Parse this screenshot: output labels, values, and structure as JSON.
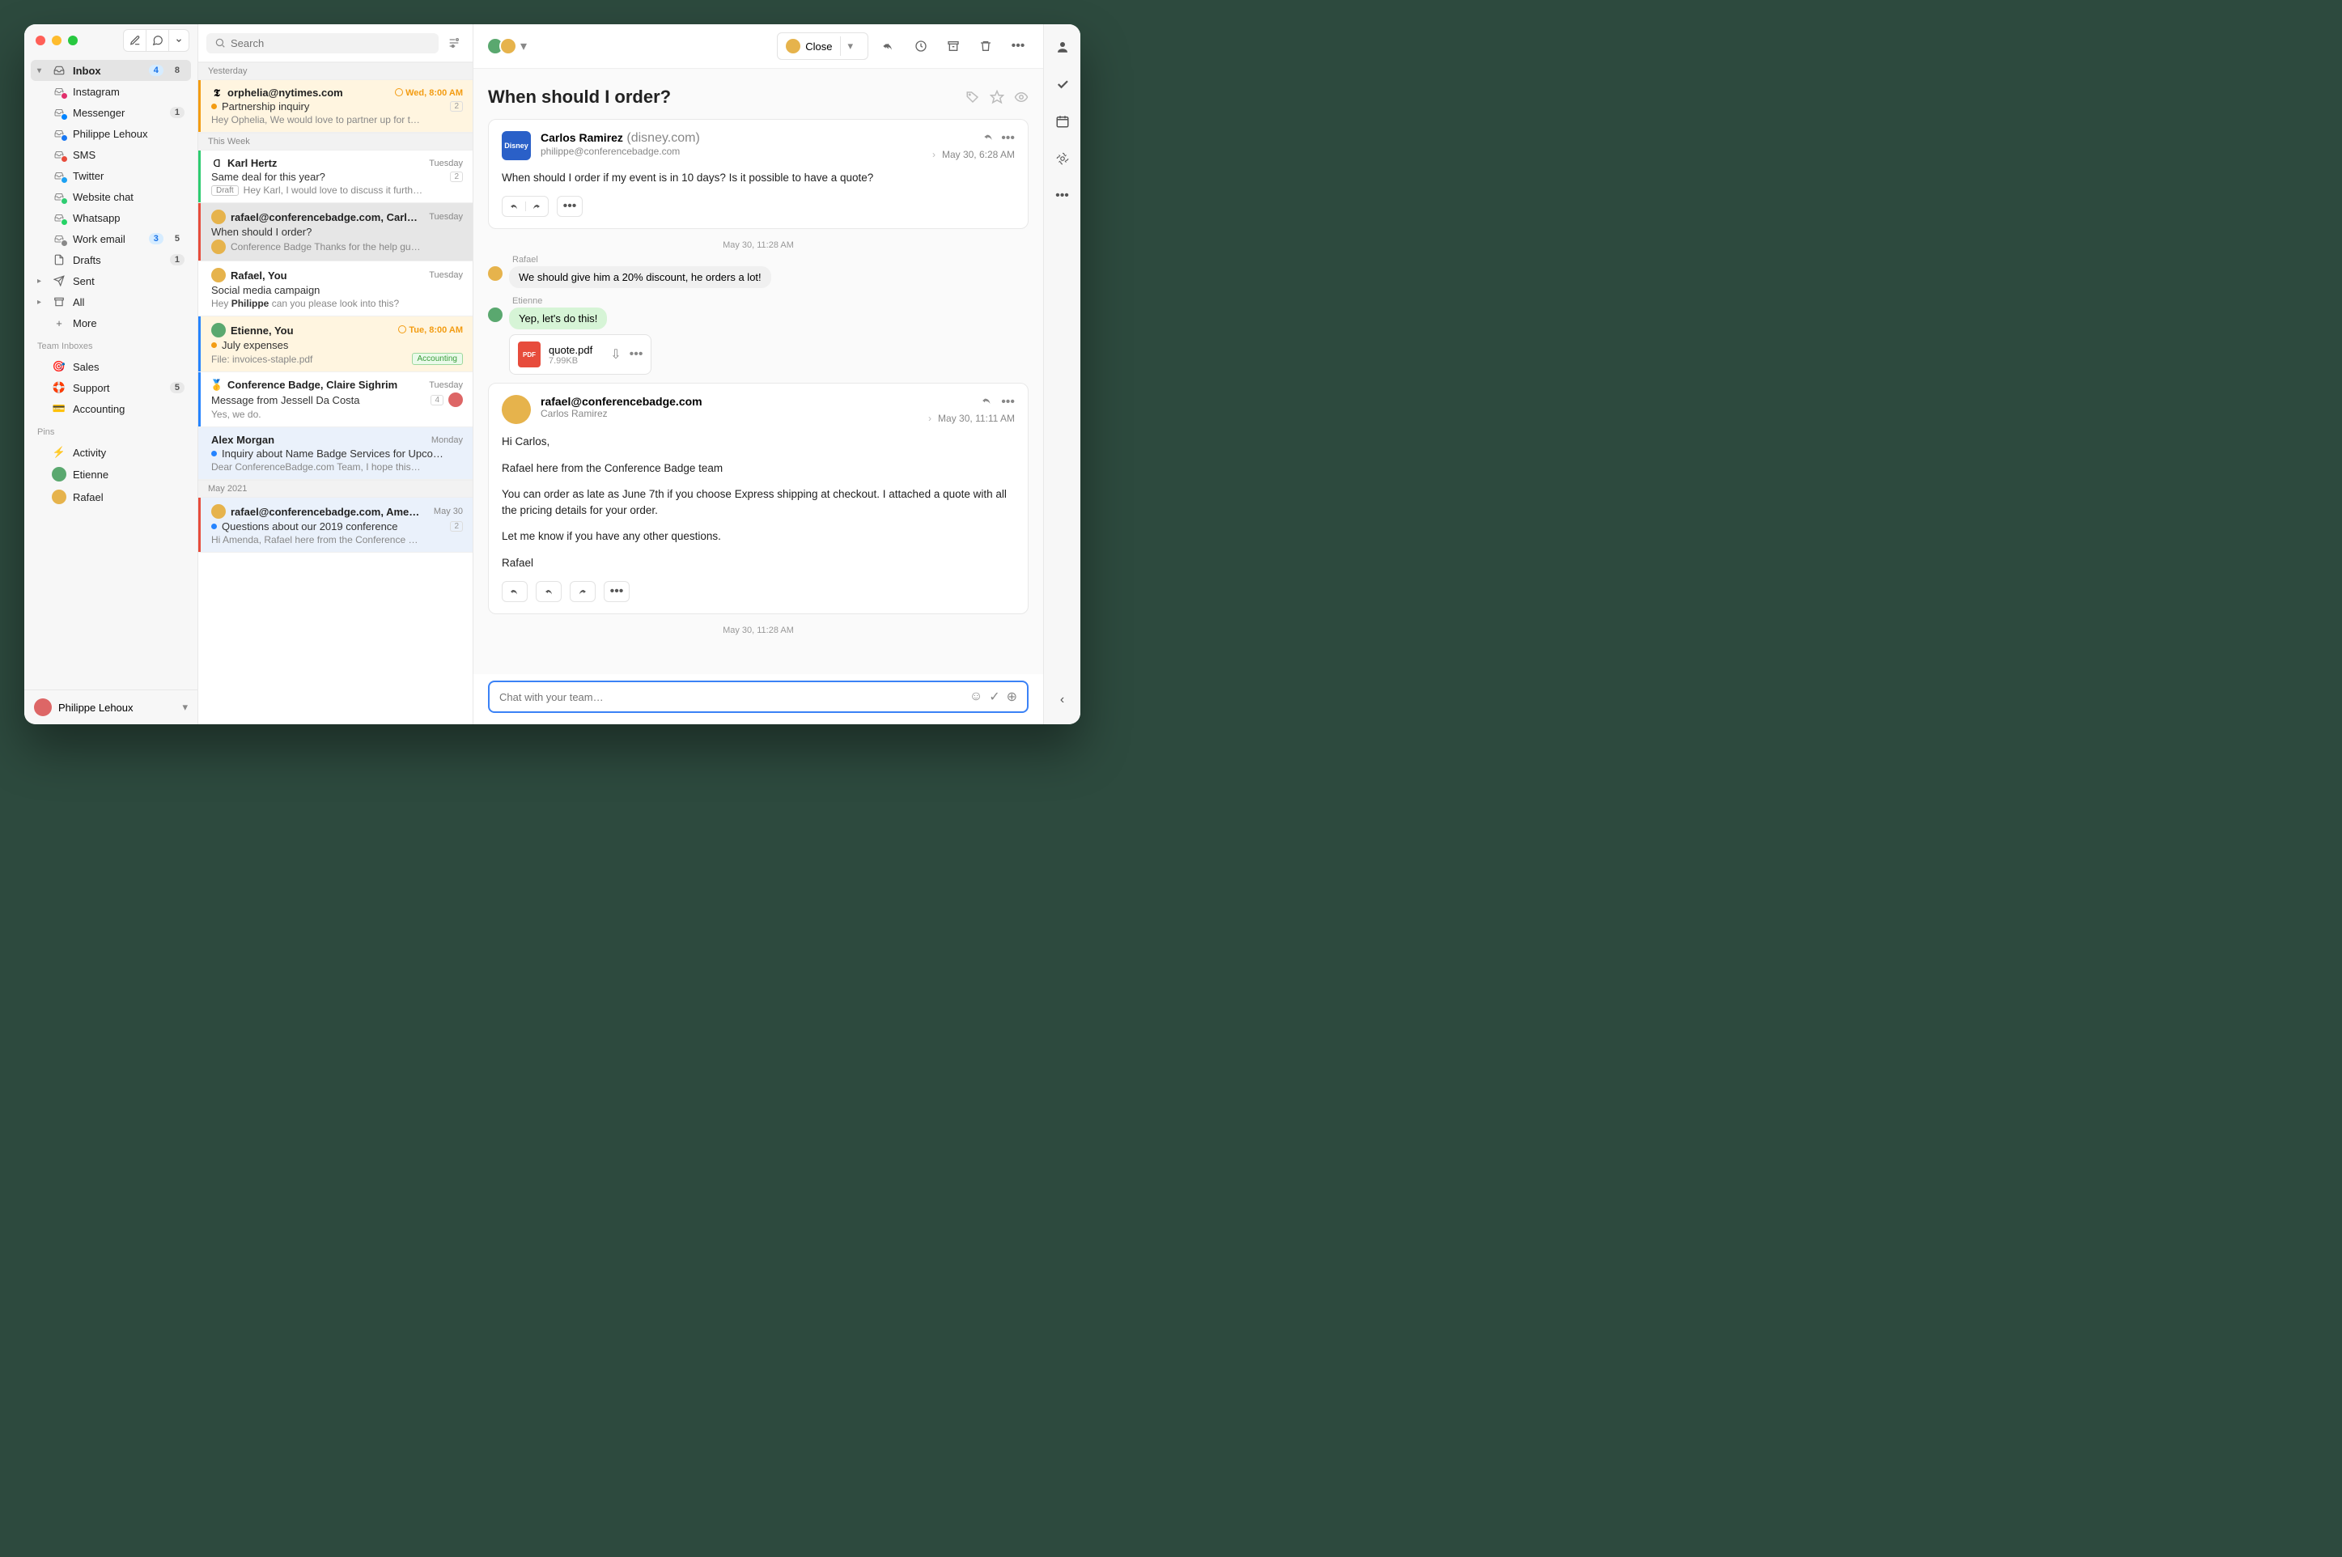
{
  "sidebar": {
    "inbox": {
      "label": "Inbox",
      "unread": "4",
      "total": "8"
    },
    "channels": [
      {
        "label": "Instagram",
        "dot": "#e1306c"
      },
      {
        "label": "Messenger",
        "dot": "#0084ff",
        "count": "1"
      },
      {
        "label": "Philippe Lehoux",
        "dot": "#1877f2"
      },
      {
        "label": "SMS",
        "dot": "#e74c3c"
      },
      {
        "label": "Twitter",
        "dot": "#1da1f2"
      },
      {
        "label": "Website chat",
        "dot": "#2ecc71"
      },
      {
        "label": "Whatsapp",
        "dot": "#25d366"
      },
      {
        "label": "Work email",
        "unread": "3",
        "total": "5"
      }
    ],
    "drafts": {
      "label": "Drafts",
      "count": "1"
    },
    "sent": {
      "label": "Sent"
    },
    "all": {
      "label": "All"
    },
    "more": {
      "label": "More"
    },
    "team_label": "Team Inboxes",
    "teams": [
      {
        "label": "Sales",
        "icon": "🎯"
      },
      {
        "label": "Support",
        "icon": "🛟",
        "count": "5"
      },
      {
        "label": "Accounting",
        "icon": "💳"
      }
    ],
    "pins_label": "Pins",
    "pins": [
      {
        "label": "Activity",
        "icon": "⚡"
      },
      {
        "label": "Etienne",
        "avatar": "#5aa86f"
      },
      {
        "label": "Rafael",
        "avatar": "#e6b34c"
      }
    ],
    "footer_user": "Philippe Lehoux"
  },
  "search": {
    "placeholder": "Search"
  },
  "groups": {
    "g0": "Yesterday",
    "g1": "This Week",
    "g2": "May 2021"
  },
  "threads": [
    {
      "from": "orphelia@nytimes.com",
      "time": "Wed, 8:00 AM",
      "time_style": "orange",
      "subj": "Partnership inquiry",
      "count": "2",
      "preview": "Hey Ophelia, We would love to partner up for t…",
      "stripe": "#f39c12",
      "highlight": true,
      "dot": "orange",
      "icon": "𝕿"
    },
    {
      "from": "Karl Hertz",
      "time": "Tuesday",
      "subj": "Same deal for this year?",
      "count": "2",
      "draft": true,
      "preview": "Hey Karl, I would love to discuss it furth…",
      "stripe": "#2ecc71",
      "icon": "disney"
    },
    {
      "from": "rafael@conferencebadge.com, Carl…",
      "time": "Tuesday",
      "subj": "When should I order?",
      "preview": "Conference Badge Thanks for the help gu…",
      "stripe": "#e74c3c",
      "selected": true,
      "avatar": "#e6b34c",
      "pre_avatar": "#e6b34c"
    },
    {
      "from": "Rafael, You",
      "time": "Tuesday",
      "subj": "Social media campaign",
      "preview": "Hey Philippe can you please look into this?",
      "avatar": "#e6b34c",
      "preview_prefix": "Hey ",
      "preview_bold": "Philippe",
      "preview_rest": " can you please look into this?",
      "icon": "sun"
    },
    {
      "from": "Etienne, You",
      "time": "Tue, 8:00 AM",
      "time_style": "orange",
      "subj": "July expenses",
      "preview": "File: invoices-staple.pdf",
      "pill": "Accounting",
      "stripe": "#2684ff",
      "highlight": true,
      "dot": "orange",
      "avatar": "#5aa86f",
      "icon": "chart"
    },
    {
      "from": "Conference Badge, Claire Sighrim",
      "time": "Tuesday",
      "subj": "Message from Jessell Da Costa",
      "count": "4",
      "preview": "Yes, we do.",
      "stripe": "#2684ff",
      "row2avatar": "#d66",
      "icon": "medal"
    },
    {
      "from": "Alex Morgan",
      "time": "Monday",
      "subj": "Inquiry about Name Badge Services for Upco…",
      "preview": "Dear ConferenceBadge.com Team, I hope this…",
      "soft": true,
      "dot": "blue"
    },
    {
      "from": "rafael@conferencebadge.com, Ame…",
      "time": "May 30",
      "subj": "Questions about our 2019 conference",
      "count": "2",
      "preview": "Hi Amenda, Rafael here from the Conference …",
      "stripe": "#e74c3c",
      "soft": true,
      "dot": "blue",
      "avatar": "#e6b34c"
    }
  ],
  "conversation": {
    "subject": "When should I order?",
    "close_label": "Close",
    "msg1": {
      "avatar_label": "Disney",
      "name": "Carlos Ramirez",
      "domain": "(disney.com)",
      "to": "philippe@conferencebadge.com",
      "date": "May 30, 6:28 AM",
      "body": "When should I order if my event is in 10 days? Is it possible to have a quote?"
    },
    "chat_ts1": "May 30, 11:28 AM",
    "chat1": {
      "name": "Rafael",
      "text": "We should give him a 20% discount, he orders a lot!"
    },
    "chat2": {
      "name": "Etienne",
      "text": "Yep, let's do this!"
    },
    "attachment": {
      "filename": "quote.pdf",
      "size": "7.99KB"
    },
    "msg2": {
      "name": "rafael@conferencebadge.com",
      "to": "Carlos Ramirez",
      "date": "May 30, 11:11 AM",
      "body_lines": [
        "Hi Carlos,",
        "Rafael here from the Conference Badge team",
        "You can order as late as June 7th if you choose Express shipping at checkout. I attached a quote with all the pricing details for your order.",
        "Let me know if you have any other questions.",
        "Rafael"
      ]
    },
    "chat_ts2": "May 30, 11:28 AM",
    "input_placeholder": "Chat with your team…"
  }
}
